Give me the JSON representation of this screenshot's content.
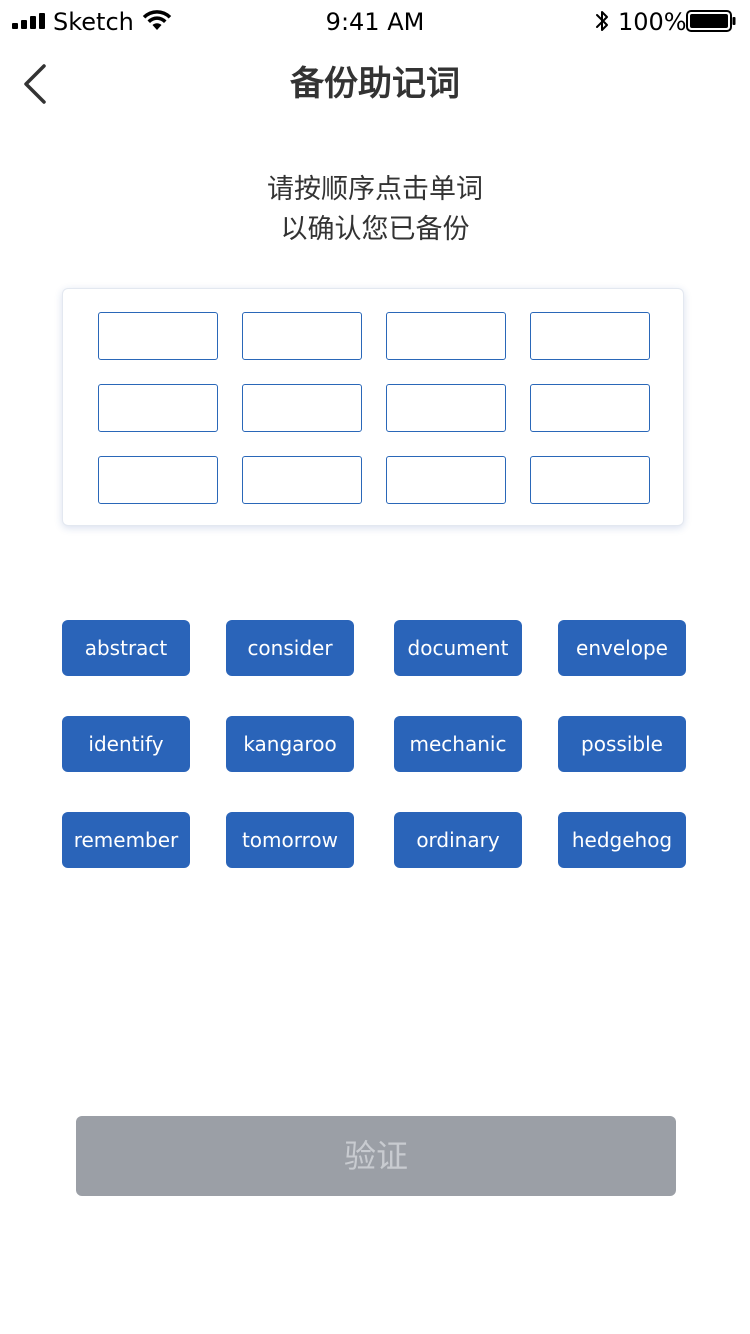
{
  "status_bar": {
    "carrier": "Sketch",
    "time": "9:41 AM",
    "battery_percent": "100%"
  },
  "nav": {
    "title": "备份助记词",
    "back_icon": "chevron-left-icon"
  },
  "instruction": {
    "line1": "请按顺序点击单词",
    "line2": "以确认您已备份"
  },
  "slots": {
    "count": 12,
    "border_color": "#2a67b8"
  },
  "words": [
    "abstract",
    "consider",
    "document",
    "envelope",
    "identify",
    "kangaroo",
    "mechanic",
    "possible",
    "remember",
    "tomorrow",
    "ordinary",
    "hedgehog"
  ],
  "verify_button": {
    "label": "验证",
    "state": "disabled"
  },
  "colors": {
    "accent": "#2a64b9",
    "disabled": "#9b9fa6",
    "text": "#333333"
  }
}
